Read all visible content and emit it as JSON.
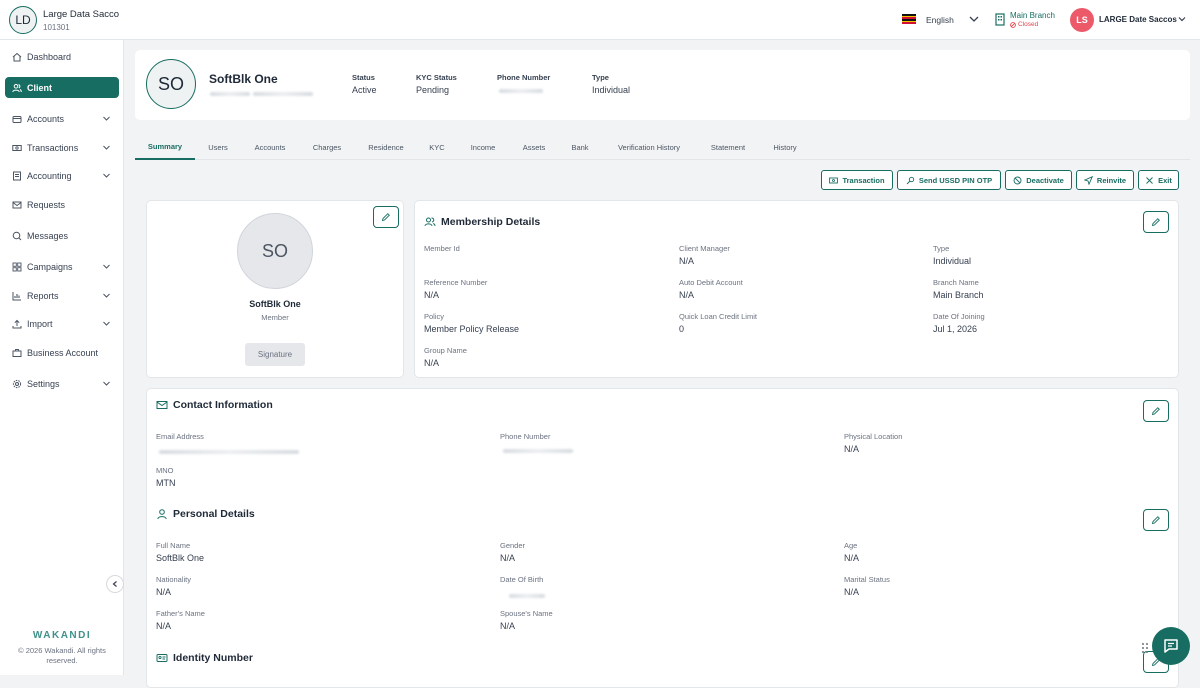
{
  "header": {
    "org_initials": "LD",
    "org_name": "Large Data Sacco",
    "org_code": "101301",
    "language": "English",
    "branch_name": "Main Branch",
    "branch_status": "Closed",
    "user_initials": "LS",
    "user_name": "LARGE Date Saccos"
  },
  "sidebar": {
    "items": [
      {
        "label": "Dashboard",
        "icon": "home-icon"
      },
      {
        "label": "Client",
        "icon": "users-icon"
      },
      {
        "label": "Accounts",
        "icon": "wallet-icon"
      },
      {
        "label": "Transactions",
        "icon": "money-icon"
      },
      {
        "label": "Accounting",
        "icon": "ledger-icon"
      },
      {
        "label": "Requests",
        "icon": "mail-icon"
      },
      {
        "label": "Messages",
        "icon": "chat-icon"
      },
      {
        "label": "Campaigns",
        "icon": "grid-icon"
      },
      {
        "label": "Reports",
        "icon": "chart-icon"
      },
      {
        "label": "Import",
        "icon": "upload-icon"
      },
      {
        "label": "Business Account",
        "icon": "briefcase-icon"
      },
      {
        "label": "Settings",
        "icon": "gear-icon"
      }
    ],
    "brand": "WAKANDI",
    "copyright": "© 2026 Wakandi. All rights reserved."
  },
  "profile": {
    "initials": "SO",
    "name": "SoftBlk One",
    "status_label": "Status",
    "status_value": "Active",
    "kyc_label": "KYC Status",
    "kyc_value": "Pending",
    "phone_label": "Phone Number",
    "type_label": "Type",
    "type_value": "Individual"
  },
  "tabs": [
    "Summary",
    "Users",
    "Accounts",
    "Charges",
    "Residence",
    "KYC",
    "Income",
    "Assets",
    "Bank",
    "Verification History",
    "Statement",
    "History"
  ],
  "actions": {
    "transaction": "Transaction",
    "send_otp": "Send USSD PIN OTP",
    "deactivate": "Deactivate",
    "reinvite": "Reinvite",
    "exit": "Exit"
  },
  "member_card": {
    "initials": "SO",
    "name": "SoftBlk One",
    "role": "Member",
    "signature_label": "Signature"
  },
  "membership": {
    "title": "Membership Details",
    "fields": {
      "member_id_label": "Member Id",
      "client_manager_label": "Client Manager",
      "client_manager_value": "N/A",
      "type_label": "Type",
      "type_value": "Individual",
      "reference_label": "Reference Number",
      "reference_value": "N/A",
      "auto_debit_label": "Auto Debit Account",
      "auto_debit_value": "N/A",
      "branch_label": "Branch Name",
      "branch_value": "Main Branch",
      "policy_label": "Policy",
      "policy_value": "Member Policy Release",
      "quick_loan_label": "Quick Loan Credit Limit",
      "quick_loan_value": "0",
      "joining_label": "Date Of Joining",
      "joining_value": "Jul 1, 2026",
      "group_label": "Group Name",
      "group_value": "N/A"
    }
  },
  "contact": {
    "title": "Contact Information",
    "email_label": "Email Address",
    "phone_label": "Phone Number",
    "location_label": "Physical Location",
    "location_value": "N/A",
    "mno_label": "MNO",
    "mno_value": "MTN"
  },
  "personal": {
    "title": "Personal Details",
    "full_name_label": "Full Name",
    "full_name_value": "SoftBlk One",
    "gender_label": "Gender",
    "gender_value": "N/A",
    "age_label": "Age",
    "age_value": "N/A",
    "nationality_label": "Nationality",
    "nationality_value": "N/A",
    "dob_label": "Date Of Birth",
    "marital_label": "Marital Status",
    "marital_value": "N/A",
    "father_label": "Father's Name",
    "father_value": "N/A",
    "spouse_label": "Spouse's Name",
    "spouse_value": "N/A"
  },
  "identity": {
    "title": "Identity Number"
  },
  "colors": {
    "primary": "#186d62",
    "danger": "#e0464e",
    "avatar_pink": "#ec5a6a"
  }
}
